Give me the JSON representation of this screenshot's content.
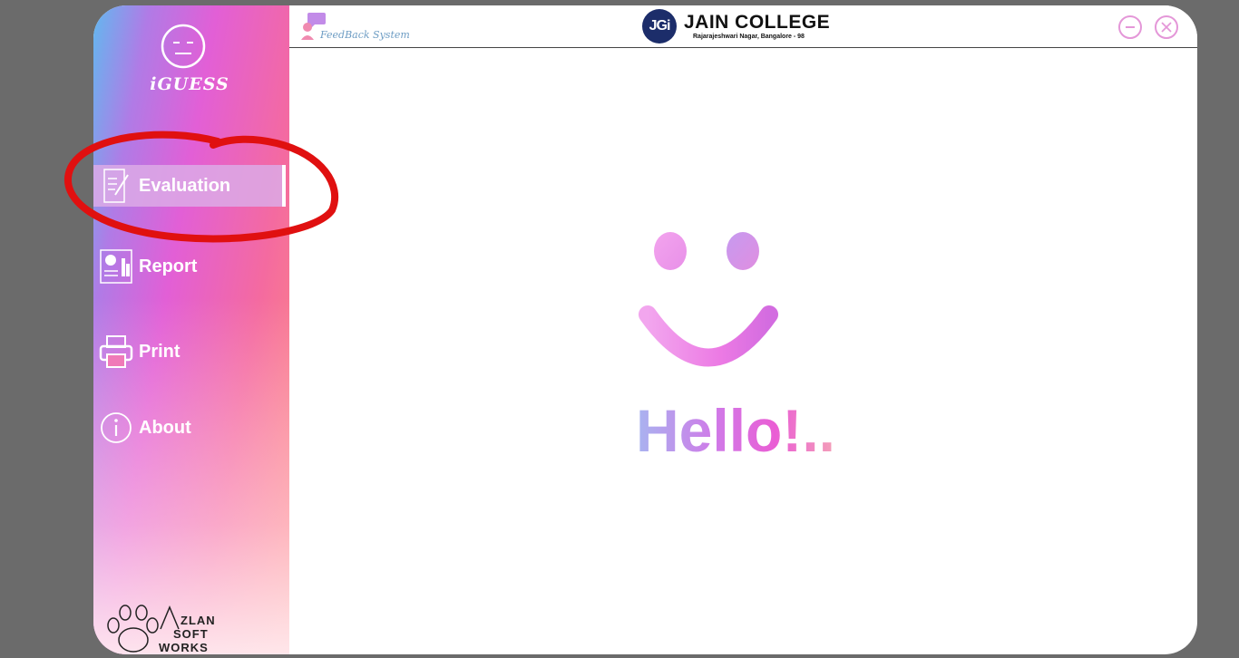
{
  "app": {
    "logo_text": "iGUESS",
    "module_name": "FeedBack System"
  },
  "college": {
    "badge": "JGi",
    "name": "JAIN COLLEGE",
    "address": "Rajarajeshwari Nagar, Bangalore - 98"
  },
  "sidebar": {
    "items": [
      {
        "label": "Evaluation",
        "icon": "evaluation-icon",
        "active": true
      },
      {
        "label": "Report",
        "icon": "report-icon",
        "active": false
      },
      {
        "label": "Print",
        "icon": "printer-icon",
        "active": false
      },
      {
        "label": "About",
        "icon": "info-icon",
        "active": false
      }
    ]
  },
  "brand": {
    "line1": "ZLAN",
    "line2": "SOFT",
    "line3": "WORKS"
  },
  "main": {
    "greeting": "Hello!.."
  },
  "colors": {
    "accent_pink": "#e25fd6",
    "annotation_red": "#e01010"
  }
}
